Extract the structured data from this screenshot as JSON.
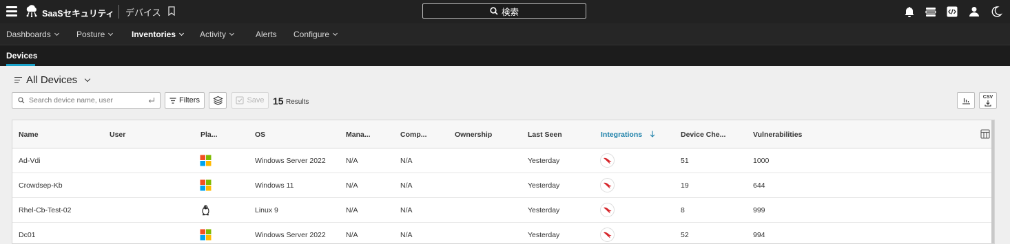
{
  "app": {
    "title": "SaaSセキュリティ",
    "section": "デバイス",
    "search_label": "検索"
  },
  "nav": {
    "items": [
      {
        "label": "Dashboards",
        "has_dropdown": true
      },
      {
        "label": "Posture",
        "has_dropdown": true
      },
      {
        "label": "Inventories",
        "has_dropdown": true,
        "active": true
      },
      {
        "label": "Activity",
        "has_dropdown": true
      },
      {
        "label": "Alerts",
        "has_dropdown": false
      },
      {
        "label": "Configure",
        "has_dropdown": true
      }
    ]
  },
  "subnav": {
    "active_tab": "Devices"
  },
  "view": {
    "title": "All Devices"
  },
  "toolbar": {
    "search_placeholder": "Search device name, user",
    "filters_label": "Filters",
    "save_label": "Save",
    "results_count": "15",
    "results_label": "Results",
    "csv_label": "CSV"
  },
  "table": {
    "columns": [
      "Name",
      "User",
      "Pla...",
      "OS",
      "Mana...",
      "Comp...",
      "Ownership",
      "Last Seen",
      "Integrations",
      "Device Che...",
      "Vulnerabilities"
    ],
    "sorted_column": "Integrations",
    "sort_direction": "desc",
    "rows": [
      {
        "name": "Ad-Vdi",
        "user": "",
        "platform": "windows",
        "os": "Windows Server 2022",
        "managed": "N/A",
        "compliance": "N/A",
        "ownership": "",
        "last_seen": "Yesterday",
        "integration": "crowdstrike",
        "device_checks": "51",
        "vulnerabilities": "1000"
      },
      {
        "name": "Crowdsep-Kb",
        "user": "",
        "platform": "windows",
        "os": "Windows 11",
        "managed": "N/A",
        "compliance": "N/A",
        "ownership": "",
        "last_seen": "Yesterday",
        "integration": "crowdstrike",
        "device_checks": "19",
        "vulnerabilities": "644"
      },
      {
        "name": "Rhel-Cb-Test-02",
        "user": "",
        "platform": "linux",
        "os": "Linux 9",
        "managed": "N/A",
        "compliance": "N/A",
        "ownership": "",
        "last_seen": "Yesterday",
        "integration": "crowdstrike",
        "device_checks": "8",
        "vulnerabilities": "999"
      },
      {
        "name": "Dc01",
        "user": "",
        "platform": "windows",
        "os": "Windows Server 2022",
        "managed": "N/A",
        "compliance": "N/A",
        "ownership": "",
        "last_seen": "Yesterday",
        "integration": "crowdstrike",
        "device_checks": "52",
        "vulnerabilities": "994"
      }
    ]
  },
  "colors": {
    "topbar_bg": "#222222",
    "accent": "#1aa2c9",
    "sorted_header": "#1a7fa8",
    "integration_red": "#d6252a"
  }
}
